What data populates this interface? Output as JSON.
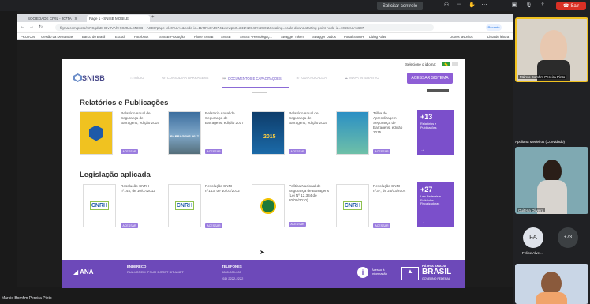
{
  "meeting": {
    "control_button": "Solicitar controle",
    "leave_button": "Sair",
    "presenter_name": "Márcio Bomfim Pereira Pinto",
    "participants": [
      {
        "name": "Márcio Bomfim Pereira Pinto"
      },
      {
        "name": "Apoliana Medeiros (Convidado)"
      },
      {
        "name": "Quiteria Oliveira"
      },
      {
        "initials": "FA",
        "name": "Felipe Alve..."
      },
      {
        "name": "+73"
      }
    ]
  },
  "browser": {
    "tabs": [
      "SOCIEDADE CIVIL - 207TA - X",
      "Page 1 - SNISB MOBILE"
    ],
    "url": "figma.com/proto/mPCgduEHDv2VAhHy8J9ALSNISB---ACEI?page-id=0%3A1&node-id=1170%3A5974&viewport=241%2C48%2C0.2&scaling=scale-down&starting-point-node-id=1055%3A6607",
    "bookmarks": [
      "PROTON",
      "Gestão da Demandas",
      "Banco do Brasil",
      "Escodi",
      "Facebook",
      "SNISB-Produção",
      "Plone SNISB",
      "SNISB",
      "SNISB - Homologaç...",
      "Swagger Token",
      "Swagger Dados",
      "Portal SNIRH",
      "Living Atlas",
      "Outros favoritos",
      "Lista de leitura"
    ],
    "profile_label": "Recanto"
  },
  "site": {
    "lang_label": "Selecione o idioma:",
    "logo_text": "SNISB",
    "nav": {
      "items": [
        "INÍCIO",
        "CONSULTAR BARRAGENS",
        "DOCUMENTOS E CAPACITAÇÕES",
        "GUIA FOCALIZA",
        "MAPA INTERATIVO"
      ],
      "access_button": "ACESSAR SISTEMA"
    },
    "reports": {
      "title": "Relatórios e Publicações",
      "items": [
        {
          "title": "Relatório Anual de Segurança de Barragens, edição 2019",
          "button": "ACESSAR"
        },
        {
          "title": "Relatório Anual de Segurança de Barragens, edição 2017",
          "button": "ACESSAR",
          "cover_text": "BARRAGENS 2017"
        },
        {
          "title": "Relatório Anual de Segurança de Barragens, edição 2015",
          "button": "ACESSAR",
          "cover_text": "2015"
        },
        {
          "title": "Trilha de Aprendizagem - Segurança de Barragens, edição 2015",
          "button": "ACESSAR"
        }
      ],
      "more": {
        "count": "+13",
        "label": "Relatórios e Publicações",
        "arrow": "→"
      }
    },
    "legislation": {
      "title": "Legislação aplicada",
      "items": [
        {
          "title": "Resolução CNRH nº144, de 10/07/2012",
          "button": "ACESSAR",
          "cover_text": "CNRH"
        },
        {
          "title": "Resolução CNRH nº143, de 10/07/2012",
          "button": "ACESSAR",
          "cover_text": "CNRH"
        },
        {
          "title": "Política Nacional de Segurança de Barragens (Lei Nº 12.334 de 20/09/2010)",
          "button": "ACESSAR"
        },
        {
          "title": "Resolução CNRH nº37, de 26/03/2004",
          "button": "ACESSAR",
          "cover_text": "CNRH"
        }
      ],
      "more": {
        "count": "+27",
        "label": "Leis Federais e Entidades Fiscalizadoras",
        "arrow": "→"
      }
    },
    "footer": {
      "ana_logo": "ANA",
      "address_label": "ENDEREÇO",
      "address_value": "RUA LOREM IPSUM DORET SIT AMET",
      "phone_label": "TELEFONES",
      "phone_1": "0800-000-000",
      "phone_2": "(61) 2222-2222",
      "info_label": "Acesso à Informação",
      "gov_line1": "PÁTRIA AMADA",
      "gov_line2": "BRASIL",
      "gov_line3": "GOVERNO FEDERAL"
    }
  },
  "colors": {
    "brand_purple": "#7b4fcb",
    "button_purple": "#8e5ed6",
    "footer_purple": "#6d49b9",
    "leave_red": "#d93025"
  }
}
